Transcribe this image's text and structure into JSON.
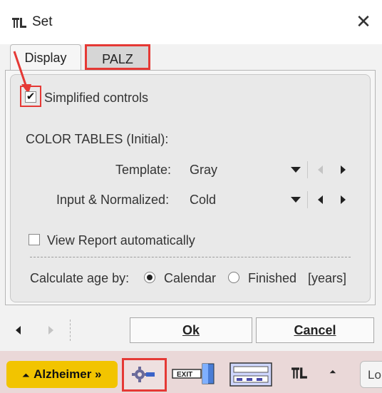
{
  "window": {
    "title": "Set"
  },
  "tabs": [
    {
      "label": "Display",
      "active": false
    },
    {
      "label": "PALZ",
      "active": true
    }
  ],
  "palz": {
    "simplified_controls": {
      "label": "Simplified controls",
      "checked": true
    },
    "color_tables_heading": "COLOR TABLES (Initial):",
    "template": {
      "label": "Template:",
      "value": "Gray"
    },
    "input_normalized": {
      "label": "Input & Normalized:",
      "value": "Cold"
    },
    "view_report": {
      "label": "View Report automatically",
      "checked": false
    },
    "calculate_age": {
      "label": "Calculate age by:",
      "options": [
        "Calendar",
        "Finished"
      ],
      "selected": "Calendar",
      "unit": "[years]"
    }
  },
  "footer": {
    "ok_label": "Ok",
    "cancel_label": "Cancel"
  },
  "taskbar": {
    "alzheimer_label": "Alzheimer »",
    "partial_label": "Lo"
  },
  "colors": {
    "highlight": "#e53935",
    "alzheimer_button": "#f2c400",
    "taskbar_bg": "#ead8d8"
  }
}
